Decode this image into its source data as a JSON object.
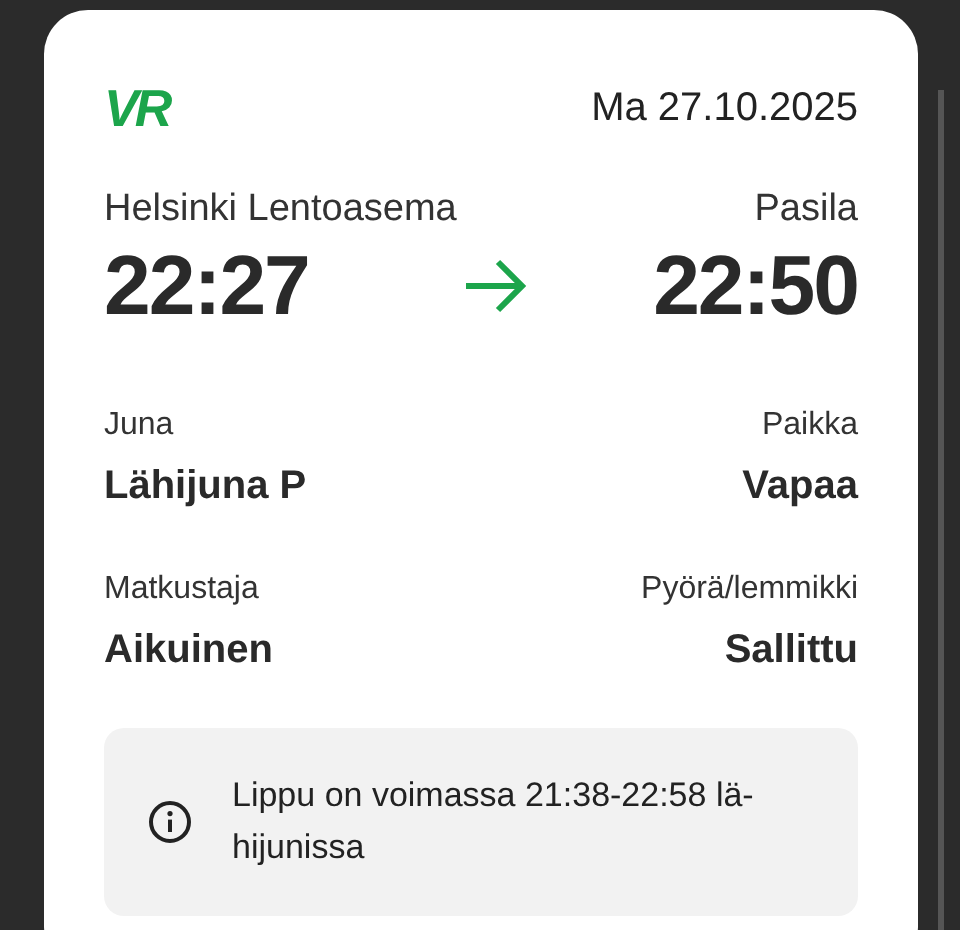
{
  "logo": "VR",
  "date": "Ma 27.10.2025",
  "from": {
    "station": "Helsinki Lentoasema",
    "time": "22:27"
  },
  "to": {
    "station": "Pasila",
    "time": "22:50"
  },
  "details": [
    {
      "left": {
        "label": "Juna",
        "value": "Lähijuna P"
      },
      "right": {
        "label": "Paikka",
        "value": "Vapaa"
      }
    },
    {
      "left": {
        "label": "Matkustaja",
        "value": "Aikuinen"
      },
      "right": {
        "label": "Pyörä/lemmikki",
        "value": "Sallittu"
      }
    }
  ],
  "notice": "Lippu on voimassa 21:38-22:58 lä-hijunissa"
}
